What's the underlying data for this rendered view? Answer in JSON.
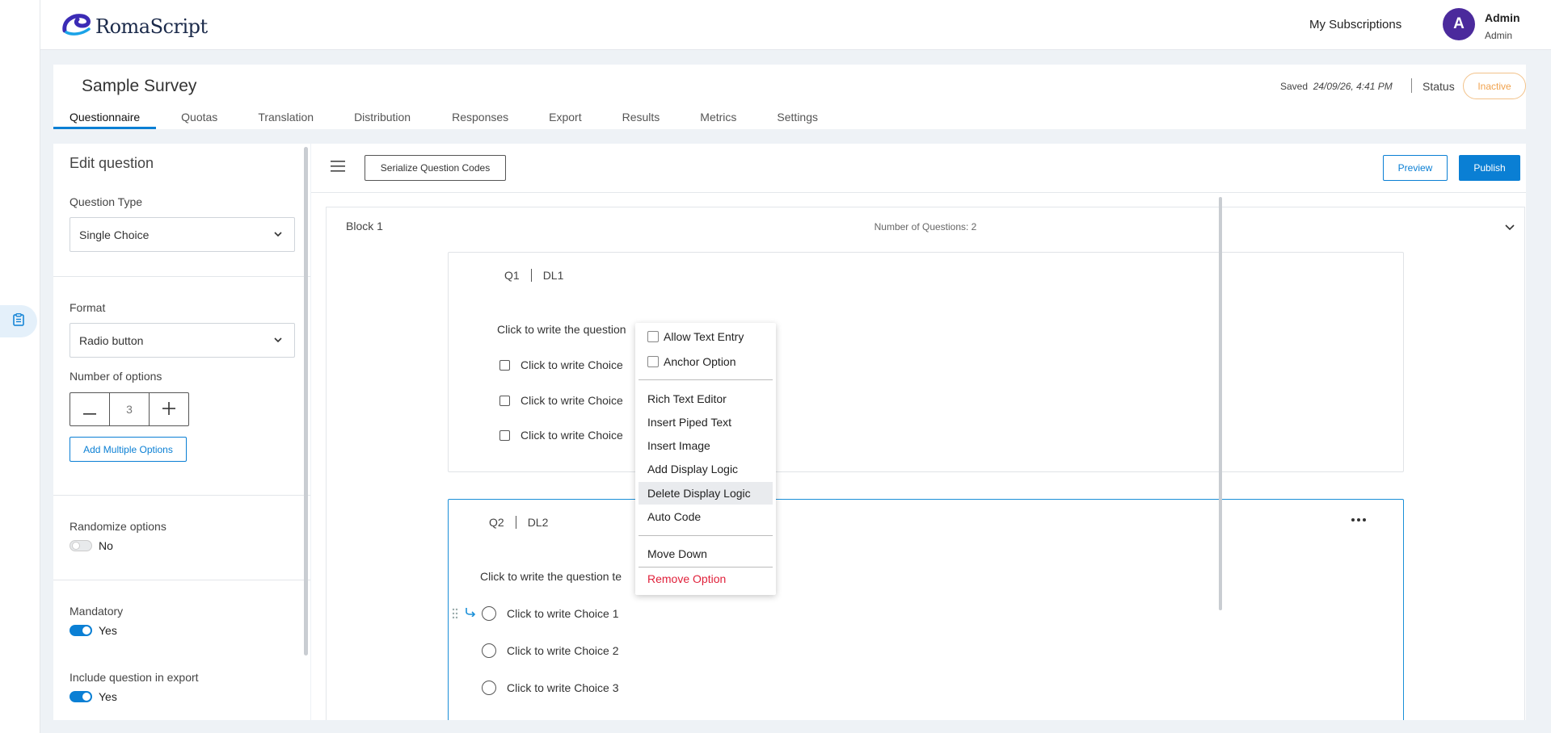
{
  "brand": {
    "name": "RomaScript"
  },
  "header": {
    "my_subscriptions": "My Subscriptions",
    "avatar_letter": "A",
    "user_name": "Admin",
    "user_role": "Admin"
  },
  "survey": {
    "title": "Sample Survey",
    "saved_label": "Saved",
    "saved_time": "24/09/26, 4:41 PM",
    "status_label": "Status",
    "status_value": "Inactive"
  },
  "tabs": [
    "Questionnaire",
    "Quotas",
    "Translation",
    "Distribution",
    "Responses",
    "Export",
    "Results",
    "Metrics",
    "Settings"
  ],
  "active_tab": "Questionnaire",
  "edit_panel": {
    "title": "Edit question",
    "question_type_label": "Question Type",
    "question_type_value": "Single Choice",
    "format_label": "Format",
    "format_value": "Radio button",
    "num_options_label": "Number of options",
    "num_options_value": "3",
    "add_multiple_label": "Add Multiple Options",
    "randomize_label": "Randomize options",
    "randomize_value": "No",
    "mandatory_label": "Mandatory",
    "mandatory_value": "Yes",
    "include_export_label": "Include question in export",
    "include_export_value": "Yes"
  },
  "toolbar": {
    "serialize_label": "Serialize Question Codes",
    "preview_label": "Preview",
    "publish_label": "Publish"
  },
  "block": {
    "title": "Block 1",
    "count_label": "Number of Questions: 2"
  },
  "questions": [
    {
      "code": "Q1",
      "logic": "DL1",
      "text": "Click to write the question",
      "choices": [
        "Click to write Choice",
        "Click to write Choice",
        "Click to write Choice"
      ]
    },
    {
      "code": "Q2",
      "logic": "DL2",
      "text": "Click to write the question te",
      "choices": [
        "Click to write Choice 1",
        "Click to write Choice 2",
        "Click to write Choice 3"
      ]
    }
  ],
  "context_menu": {
    "allow_text_entry": "Allow Text Entry",
    "anchor_option": "Anchor Option",
    "rich_text_editor": "Rich Text Editor",
    "insert_piped_text": "Insert Piped Text",
    "insert_image": "Insert Image",
    "add_display_logic": "Add Display Logic",
    "delete_display_logic": "Delete Display Logic",
    "auto_code": "Auto Code",
    "move_down": "Move Down",
    "remove_option": "Remove Option"
  },
  "colors": {
    "accent": "#0a7fd4",
    "avatar": "#4b2a9c",
    "inactive": "#f0a24d",
    "danger": "#e0203a"
  }
}
